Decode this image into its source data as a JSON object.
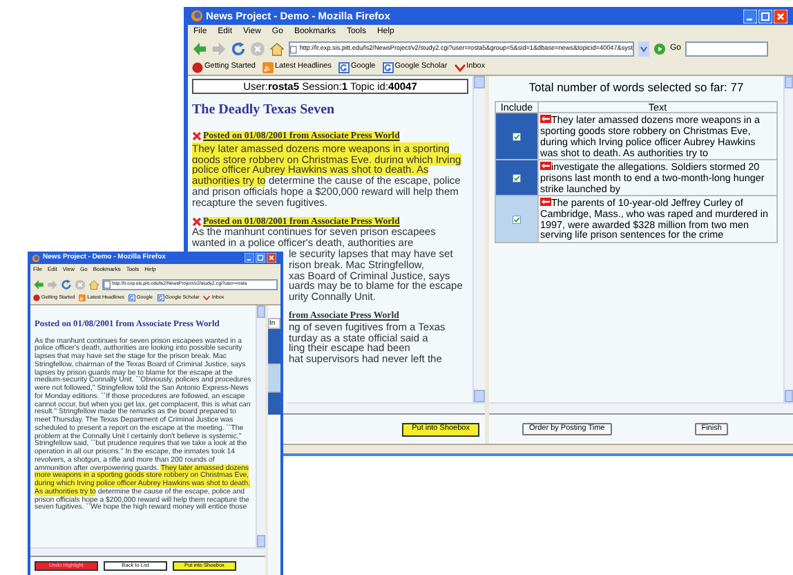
{
  "main_window": {
    "title": "News Project - Demo - Mozilla Firefox",
    "menu": [
      "File",
      "Edit",
      "View",
      "Go",
      "Bookmarks",
      "Tools",
      "Help"
    ],
    "url": "http://lr.exp.sis.pitt.edu/ls2/NewsProject/v2/study2.cgi?user=rosta5&group=5&sid=1&dbase=news&topicid=40047&syst",
    "go_label": "Go",
    "bookmarks": [
      "Getting Started",
      "Latest Headlines",
      "Google",
      "Google Scholar",
      "Inbox"
    ],
    "left_pane": {
      "user_line": "User:**rosta5** Session:**1** Topic id:**40047**",
      "title": "The Deadly Texas Seven",
      "posts": [
        {
          "kind": "paragraph",
          "header": {
            "text": "Posted on 01/08/2001 from Associate Press World",
            "highlighted": true,
            "removable": true,
            "partly_hidden": false
          },
          "segments": [
            {
              "text": "They later amassed dozens more weapons in a sporting goods store robbery on Christmas Eve, during which Irving police officer Aubrey Hawkins was shot to death. As authorities try to",
              "highlighted": true
            },
            {
              "text": "determine the cause of the escape, police and prison officials hope a $200,000 reward will help them recapture the seven fugitives.",
              "highlighted": false
            }
          ]
        },
        {
          "kind": "lines",
          "header": {
            "text": "Posted on 01/08/2001 from Associate Press World",
            "highlighted": true,
            "removable": true,
            "partly_hidden": false
          },
          "lines": [
            {
              "text": "As the manhunt continues for seven prison escapees",
              "partly_hidden": false
            },
            {
              "text": "wanted in a police officer's death, authorities are",
              "partly_hidden": false
            },
            {
              "text": "le security lapses that may have set",
              "partly_hidden": true
            },
            {
              "text": "rison break. Mac Stringfellow,",
              "partly_hidden": true
            },
            {
              "text": "xas Board of Criminal Justice, says",
              "partly_hidden": true
            },
            {
              "text": "uards may be to blame for the escape",
              "partly_hidden": true
            },
            {
              "text": "urity Connally Unit.",
              "partly_hidden": true
            }
          ]
        },
        {
          "kind": "lines",
          "header": {
            "text": "from Associate Press World",
            "highlighted": false,
            "partly_hidden": true
          },
          "lines": [
            {
              "text": "ng of seven fugitives from a Texas",
              "partly_hidden": true
            },
            {
              "text": "turday as a state official said a",
              "partly_hidden": true
            },
            {
              "text": "ling their escape had been",
              "partly_hidden": true
            },
            {
              "text": "hat supervisors had never left the",
              "partly_hidden": true
            }
          ]
        }
      ],
      "button": "Put into Shoebox"
    },
    "right_pane": {
      "summary": "Total number of words selected so far: 77",
      "columns": [
        "Include",
        "Text"
      ],
      "rows": [
        {
          "selected": true,
          "checked": true,
          "text": "They later amassed dozens more weapons in a sporting goods store robbery on Christmas Eve, during which Irving police officer Aubrey Hawkins was shot to death. As authorities try to"
        },
        {
          "selected": true,
          "checked": true,
          "text": "investigate the allegations. Soldiers stormed 20 prisons last month to end a two-month-long hunger strike launched by"
        },
        {
          "selected": false,
          "checked": true,
          "text": "The parents of 10-year-old Jeffrey Curley of Cambridge, Mass., who was raped and murdered in 1997, were awarded $328 million from two men serving life prison sentences for the crime"
        }
      ],
      "buttons": [
        "Order by Posting Time",
        "Finish"
      ]
    }
  },
  "popup_window": {
    "title": "News Project - Demo - Mozilla Firefox",
    "menu": [
      "File",
      "Edit",
      "View",
      "Go",
      "Bookmarks",
      "Tools",
      "Help"
    ],
    "url": "http://lr.exp.sis.pitt.edu/ls2/NewsProject/v2/study2.cgi?user=rosta",
    "bookmarks": [
      "Getting Started",
      "Latest Headlines",
      "Google",
      "Google Scholar",
      "Inbox"
    ],
    "header": "Posted on 01/08/2001 from Associate Press World",
    "segments": [
      {
        "text": "As the manhunt continues for seven prison escapees wanted in a police officer's death, authorities are looking into possible security lapses that may have set the stage for the prison break. Mac Stringfellow, chairman of the Texas Board of Criminal Justice, says lapses by prison guards may be to blame for the escape at the medium-security Connally Unit. ``Obviously, policies and procedures were not followed,'' Stringfellow told the San Antonio Express-News for Monday editions. ``If those procedures are followed, an escape cannot occur, but when you get lax, get complacent, this is what can result.'' Stringfellow made the remarks as the board prepared to meet Thursday. The Texas Department of Criminal Justice was scheduled to present a report on the escape at the meeting. ``The problem at the Connally Unit I certainly don't believe is systemic,'' Stringfellow said, ``but prudence requires that we take a look at the operation in all our prisons.'' In the escape, the inmates took 14 revolvers, a shotgun, a rifle and more than 200 rounds of ammunition after overpowering guards.",
        "highlighted": false
      },
      {
        "text": "They later amassed dozens more weapons in a sporting goods store robbery on Christmas Eve, during which Irving police officer Aubrey Hawkins was shot to death. As authorities try to",
        "highlighted": true
      },
      {
        "text": "determine the cause of the escape, police and prison officials hope a $200,000 reward will help them recapture the seven fugitives. ``We hope the high reward money will entice those",
        "highlighted": false
      }
    ],
    "side_column": "In",
    "buttons": [
      {
        "label": "Undo Highlight",
        "kind": "danger"
      },
      {
        "label": "Back to List",
        "kind": "plain"
      },
      {
        "label": "Put into Shoebox",
        "kind": "accent"
      }
    ]
  }
}
